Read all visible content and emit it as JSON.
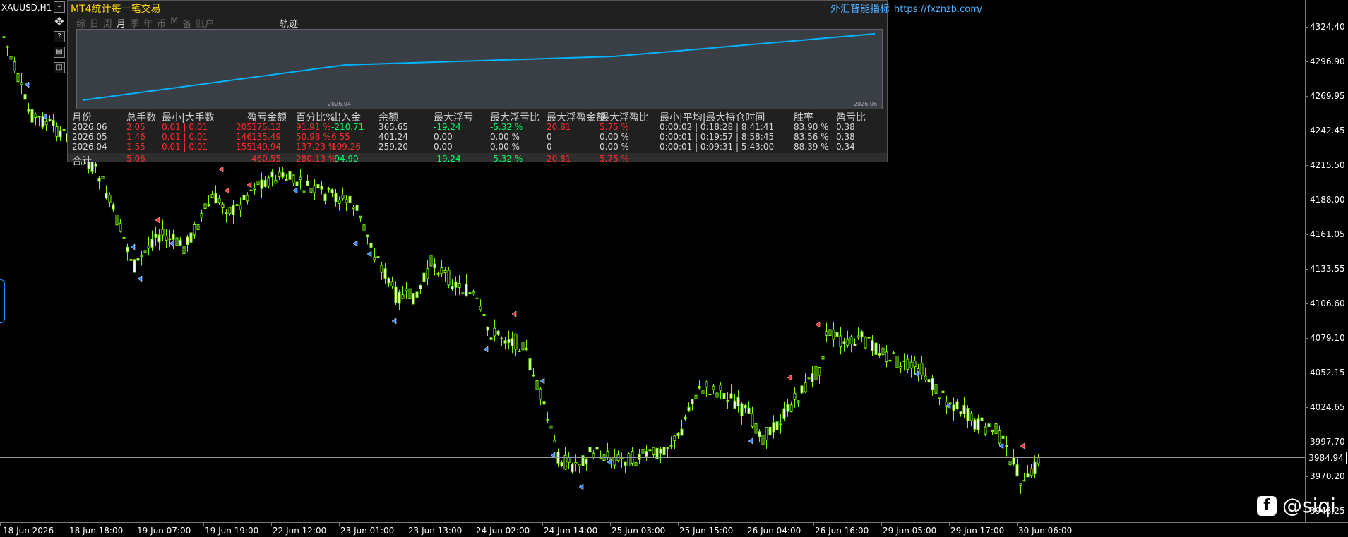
{
  "symbol": "XAUUSD,H1",
  "panel": {
    "title": "MT4统计每一笔交易",
    "brand": "外汇智能指标",
    "brand_url": "https://fxznzb.com/",
    "tabs": [
      "综",
      "日",
      "周",
      "月",
      "季",
      "年",
      "币",
      "M",
      "备",
      "账户"
    ],
    "active_tab": "月",
    "track": "轨迹",
    "equity_start_label": "2026.04",
    "equity_end_label": "2026.06",
    "headers": [
      "月份",
      "总手数",
      "最小|大手数",
      "数",
      "盈亏金额",
      "百分比%",
      "出入金",
      "余额",
      "最大浮亏",
      "最大浮亏比",
      "最大浮盈金额",
      "最大浮盈比",
      "最小|平均|最大持仓时间",
      "胜率",
      "盈亏比"
    ],
    "rows": [
      {
        "month": "2026.06",
        "lots": "2.05",
        "minmax": "0.01 | 0.01",
        "count": "205",
        "pnl": "175.12",
        "pct": "91.91 %",
        "io": "-210.71",
        "balance": "365.65",
        "maxdd": "-19.24",
        "maxddpct": "-5.32 %",
        "maxfp": "20.81",
        "maxfppct": "5.75 %",
        "hold": "0:00:02 | 0:18:28 | 8:41:41",
        "win": "83.90 %",
        "pf": "0.38"
      },
      {
        "month": "2026.05",
        "lots": "1.46",
        "minmax": "0.01 | 0.01",
        "count": "146",
        "pnl": "135.49",
        "pct": "50.98 %",
        "io": "6.55",
        "balance": "401.24",
        "maxdd": "0.00",
        "maxddpct": "0.00 %",
        "maxfp": "0",
        "maxfppct": "0.00 %",
        "hold": "0:00:01 | 0:19:57 | 8:58:45",
        "win": "83.56 %",
        "pf": "0.38"
      },
      {
        "month": "2026.04",
        "lots": "1.55",
        "minmax": "0.01 | 0.01",
        "count": "155",
        "pnl": "149.94",
        "pct": "137.23 %",
        "io": "109.26",
        "balance": "259.20",
        "maxdd": "0.00",
        "maxddpct": "0.00 %",
        "maxfp": "0",
        "maxfppct": "0.00 %",
        "hold": "0:00:01 | 0:09:31 | 5:43:00",
        "win": "88.39 %",
        "pf": "0.34"
      }
    ],
    "total": {
      "label": "合计",
      "lots": "5.06",
      "pnl": "460.55",
      "pct": "280.13 %",
      "io": "-94.90",
      "maxdd": "-19.24",
      "maxddpct": "-5.32 %",
      "maxfp": "20.81",
      "maxfppct": "5.75 %"
    }
  },
  "price_axis": [
    "4324.40",
    "4296.90",
    "4269.95",
    "4242.45",
    "4215.50",
    "4188.00",
    "4161.05",
    "4133.55",
    "4106.60",
    "4079.10",
    "4052.15",
    "4024.65",
    "3997.70",
    "3970.20",
    "3943.25"
  ],
  "current_price": "3984.94",
  "time_axis": [
    "18 Jun 2026",
    "18 Jun 18:00",
    "19 Jun 07:00",
    "19 Jun 19:00",
    "22 Jun 12:00",
    "23 Jun 01:00",
    "23 Jun 13:00",
    "24 Jun 02:00",
    "24 Jun 14:00",
    "25 Jun 03:00",
    "25 Jun 15:00",
    "26 Jun 04:00",
    "26 Jun 16:00",
    "29 Jun 05:00",
    "29 Jun 17:00",
    "30 Jun 06:00"
  ],
  "watermark": "@siqi",
  "colors": {
    "bull": "#7CFC00",
    "bear": "#ffffff",
    "equity": "#00b4ff",
    "title": "#ffd700",
    "brand": "#4fb0ff",
    "loss": "#ff2a2a",
    "gain": "#00ff66"
  }
}
